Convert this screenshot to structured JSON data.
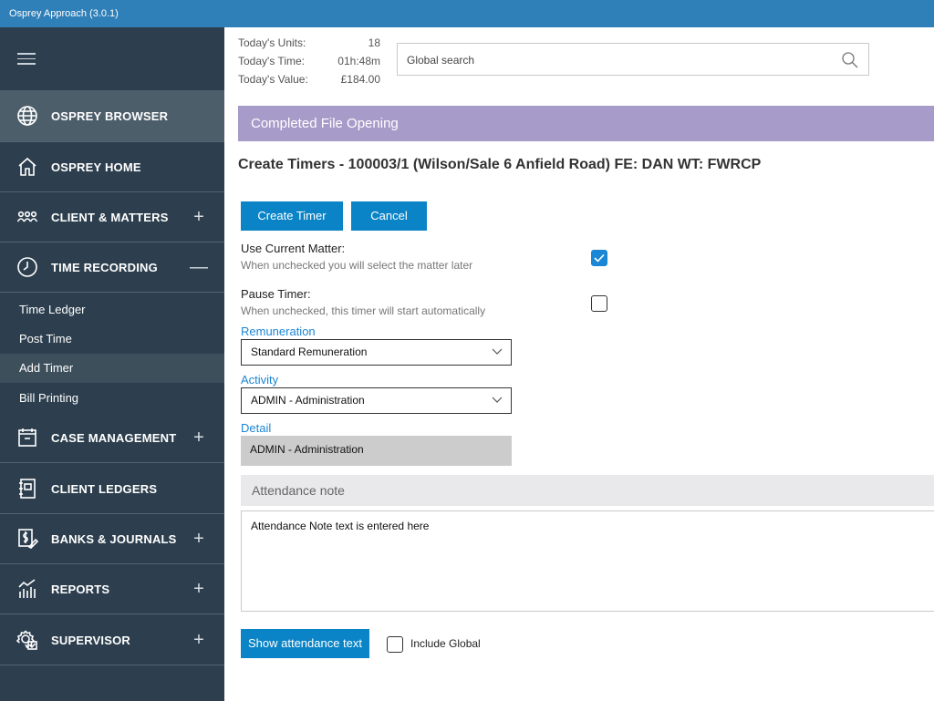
{
  "window": {
    "title": "Osprey Approach (3.0.1)"
  },
  "sidebar": {
    "nav": [
      {
        "label": "OSPREY BROWSER",
        "icon": "globe-icon",
        "toggle": ""
      },
      {
        "label": "OSPREY HOME",
        "icon": "home-icon",
        "toggle": ""
      },
      {
        "label": "CLIENT & MATTERS",
        "icon": "people-icon",
        "toggle": "+"
      },
      {
        "label": "TIME RECORDING",
        "icon": "clock-icon",
        "toggle": "—"
      },
      {
        "label": "CASE MANAGEMENT",
        "icon": "calendar-icon",
        "toggle": "+"
      },
      {
        "label": "CLIENT LEDGERS",
        "icon": "ledger-icon",
        "toggle": ""
      },
      {
        "label": "BANKS & JOURNALS",
        "icon": "bank-icon",
        "toggle": "+"
      },
      {
        "label": "REPORTS",
        "icon": "chart-icon",
        "toggle": "+"
      },
      {
        "label": "SUPERVISOR",
        "icon": "supervisor-gear-icon",
        "toggle": "+"
      }
    ],
    "time_recording_items": [
      "Time Ledger",
      "Post Time",
      "Add Timer",
      "Bill Printing"
    ]
  },
  "stats": {
    "units_label": "Today's Units:",
    "units_value": "18",
    "time_label": "Today's Time:",
    "time_value": "01h:48m",
    "value_label": "Today's Value:",
    "value_value": "£184.00"
  },
  "search": {
    "placeholder": "Global search"
  },
  "banner": {
    "text": "Completed File Opening"
  },
  "page": {
    "title": "Create Timers - 100003/1 (Wilson/Sale 6 Anfield Road) FE: DAN WT: FWRCP"
  },
  "buttons": {
    "create": "Create Timer",
    "cancel": "Cancel",
    "show_attendance": "Show attendance text"
  },
  "use_current_matter": {
    "label": "Use Current Matter:",
    "hint": "When unchecked you will select the matter later",
    "checked": true
  },
  "pause_timer": {
    "label": "Pause Timer:",
    "hint": "When unchecked, this timer will start automatically",
    "checked": false
  },
  "remuneration": {
    "label": "Remuneration",
    "value": "Standard Remuneration"
  },
  "activity": {
    "label": "Activity",
    "value": "ADMIN - Administration"
  },
  "detail": {
    "label": "Detail",
    "value": "ADMIN - Administration"
  },
  "attendance": {
    "header": "Attendance note",
    "text": "Attendance Note text is entered here"
  },
  "include_global": {
    "label": "Include Global",
    "checked": false
  },
  "colors": {
    "accent": "#0a84c6",
    "banner": "#a79bc9",
    "sidebar": "#2d3f4e",
    "titlebar": "#2f7fb8"
  }
}
